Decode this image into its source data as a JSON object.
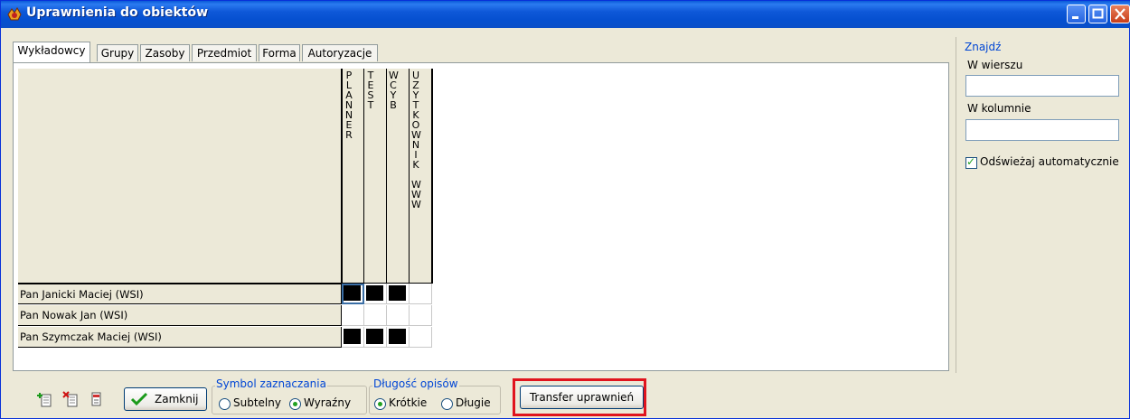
{
  "window": {
    "title": "Uprawnienia do obiektów"
  },
  "tabs": [
    {
      "label": "Wykładowcy",
      "active": true
    },
    {
      "label": "Grupy",
      "active": false
    },
    {
      "label": "Zasoby",
      "active": false
    },
    {
      "label": "Przedmiot",
      "active": false
    },
    {
      "label": "Forma",
      "active": false
    },
    {
      "label": "Autoryzacje",
      "active": false
    }
  ],
  "grid": {
    "columns": [
      {
        "label": "PLANNER",
        "lines": [
          "P",
          "L",
          "A",
          "N",
          "N",
          "E",
          "R"
        ]
      },
      {
        "label": "TEST",
        "lines": [
          "T",
          "E",
          "S",
          "T"
        ]
      },
      {
        "label": "WCYB",
        "lines": [
          "W",
          "C",
          "Y",
          "B"
        ]
      },
      {
        "label": "UZYTKOWNIK WWW",
        "lines": [
          "U",
          "Z",
          "Y",
          "T",
          "K",
          "O",
          "W",
          "N",
          "I",
          "K",
          "",
          "W",
          "W",
          "W"
        ]
      }
    ],
    "rows": [
      {
        "label": "Pan Janicki Maciej  (WSI)",
        "cells": [
          true,
          true,
          true,
          false
        ]
      },
      {
        "label": "Pan Nowak Jan  (WSI)",
        "cells": [
          false,
          false,
          false,
          false
        ]
      },
      {
        "label": "Pan Szymczak Maciej  (WSI)",
        "cells": [
          true,
          true,
          true,
          false
        ]
      }
    ]
  },
  "find_panel": {
    "title": "Znajdź",
    "row_label": "W wierszu",
    "row_value": "",
    "column_label": "W kolumnie",
    "column_value": "",
    "auto_refresh_label": "Odświeżaj automatycznie",
    "auto_refresh_checked": true
  },
  "toolbar": {
    "close_label": "Zamknij",
    "symbol_group_title": "Symbol zaznaczania",
    "symbol_options": [
      "Subtelny",
      "Wyraźny"
    ],
    "symbol_selected": "Wyraźny",
    "length_group_title": "Długość opisów",
    "length_options": [
      "Krótkie",
      "Długie"
    ],
    "length_selected": "Krótkie",
    "transfer_label": "Transfer uprawnień"
  },
  "colors": {
    "titlebar": "#0a5ad8",
    "group_title": "#0046d5",
    "highlight": "#e0141e",
    "check": "#21a121"
  }
}
